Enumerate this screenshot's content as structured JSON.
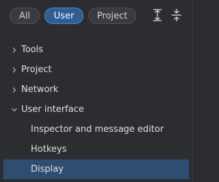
{
  "filters": {
    "all": "All",
    "user": "User",
    "project": "Project",
    "active": "User"
  },
  "toolbar": {
    "expand_icon": "expand-all-icon",
    "collapse_icon": "collapse-all-icon"
  },
  "tree": {
    "items": [
      {
        "label": "Tools",
        "expanded": false
      },
      {
        "label": "Project",
        "expanded": false
      },
      {
        "label": "Network",
        "expanded": false
      },
      {
        "label": "User interface",
        "expanded": true
      }
    ],
    "children": [
      {
        "label": "Inspector and message editor"
      },
      {
        "label": "Hotkeys"
      },
      {
        "label": "Display",
        "selected": true
      }
    ]
  },
  "colors": {
    "background": "#2b2d30",
    "accent": "#2e5e94",
    "selection": "#2e4d70"
  }
}
